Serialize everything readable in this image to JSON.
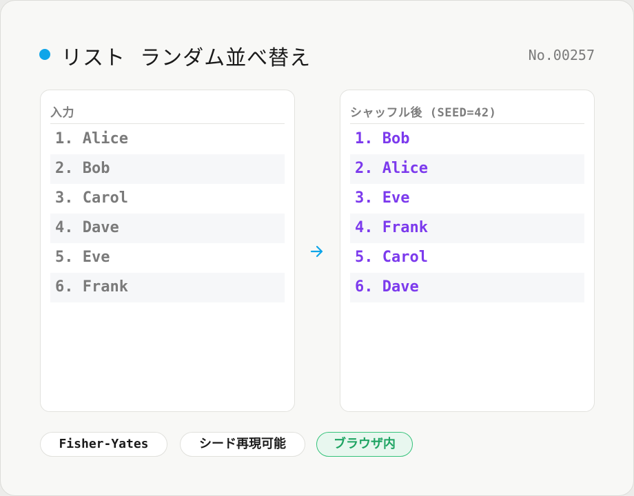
{
  "header": {
    "title": "リスト  ランダム並べ替え",
    "serial": "No.00257",
    "accent_color": "#0ea5e9"
  },
  "input_panel": {
    "heading": "入力",
    "items": [
      "1. Alice",
      "2. Bob",
      "3. Carol",
      "4. Dave",
      "5. Eve",
      "6. Frank"
    ]
  },
  "arrow_icon": "right-arrow-icon",
  "output_panel": {
    "heading": "シャッフル後 (SEED=42)",
    "items": [
      "1. Bob",
      "2. Alice",
      "3. Eve",
      "4. Frank",
      "5. Carol",
      "6. Dave"
    ],
    "text_color": "#7c3aed"
  },
  "tags": [
    "Fisher-Yates",
    "シード再現可能",
    "ブラウザ内"
  ]
}
